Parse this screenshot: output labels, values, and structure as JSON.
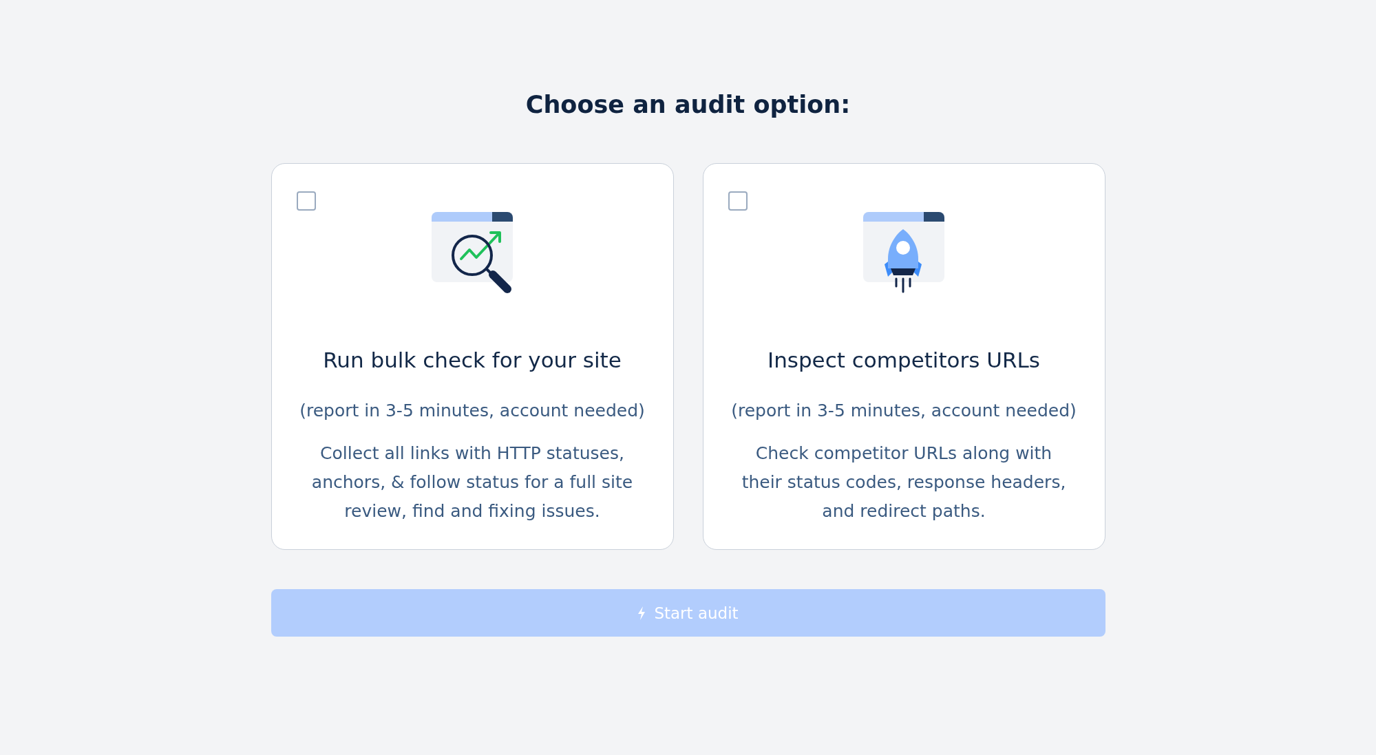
{
  "heading": "Choose an audit option:",
  "options": [
    {
      "kind": "analysis",
      "checked": false,
      "title": "Run bulk check for your site",
      "note": "(report in 3-5 minutes, account needed)",
      "description": "Collect all links with HTTP statuses, anchors, & follow status for a full site review, find and fixing issues."
    },
    {
      "kind": "rocket",
      "checked": false,
      "title": "Inspect competitors URLs",
      "note": "(report in 3-5 minutes, account needed)",
      "description": "Check competitor URLs along with their status codes, response headers, and redirect paths."
    }
  ],
  "start_button": {
    "label": "Start audit",
    "disabled": true
  }
}
